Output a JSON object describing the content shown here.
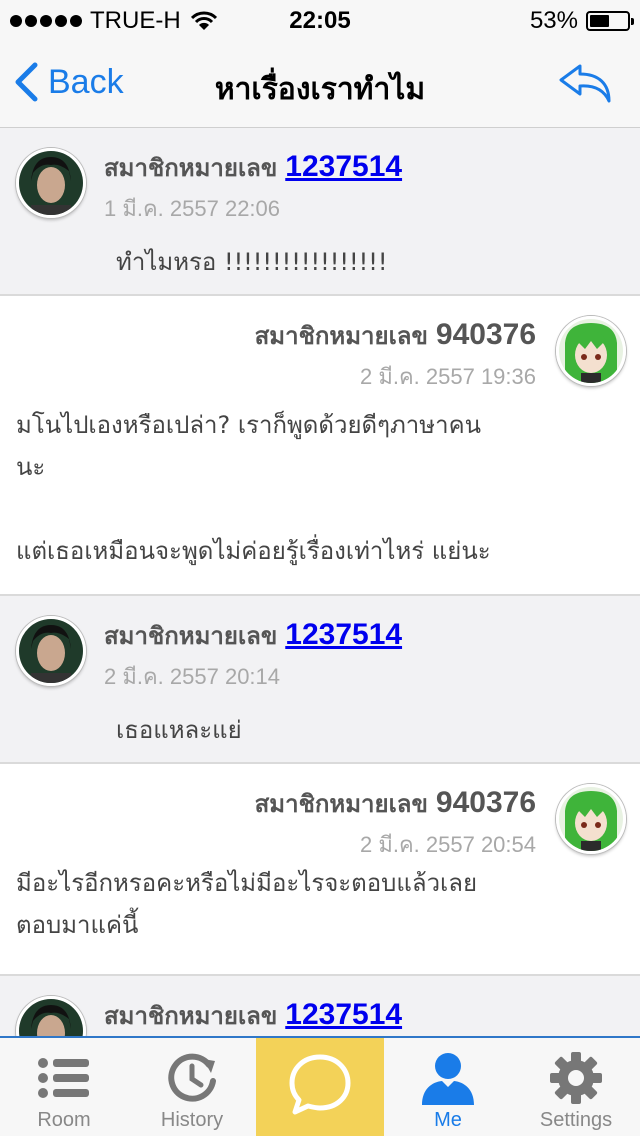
{
  "status_bar": {
    "carrier": "TRUE-H",
    "time": "22:05",
    "battery_percent": "53%",
    "battery_level": 0.53
  },
  "nav": {
    "back_label": "Back",
    "title": "หาเรื่องเราทำไม",
    "reply_icon": "reply-arrow-icon"
  },
  "messages": [
    {
      "side": "left",
      "member_label": "สมาชิกหมายเลข",
      "member_number": "1237514",
      "date": "1 มี.ค. 2557 22:06",
      "text": "ทำไมหรอ   !!!!!!!!!!!!!!!!!"
    },
    {
      "side": "right",
      "member_label": "สมาชิกหมายเลข",
      "member_number": "940376",
      "date": "2 มี.ค. 2557 19:36",
      "text": "มโนไปเองหรือเปล่า? เราก็พูดด้วยดีๆภาษาคน\nนะ\n\nแต่เธอเหมือนจะพูดไม่ค่อยรู้เรื่องเท่าไหร่ แย่นะ"
    },
    {
      "side": "left",
      "member_label": "สมาชิกหมายเลข",
      "member_number": "1237514",
      "date": "2 มี.ค. 2557 20:14",
      "text": "เธอแหละแย่"
    },
    {
      "side": "right",
      "member_label": "สมาชิกหมายเลข",
      "member_number": "940376",
      "date": "2 มี.ค. 2557 20:54",
      "text": "มีอะไรอีกหรอคะหรือไม่มีอะไรจะตอบแล้วเลย\nตอบมาแค่นี้"
    },
    {
      "side": "left",
      "member_label": "สมาชิกหมายเลข",
      "member_number": "1237514",
      "date": "",
      "text": ""
    }
  ],
  "tabs": [
    {
      "label": "Room",
      "icon": "list-icon",
      "active": false
    },
    {
      "label": "History",
      "icon": "history-clock-icon",
      "active": false
    },
    {
      "label": "",
      "icon": "chat-bubble-icon",
      "active": false
    },
    {
      "label": "Me",
      "icon": "person-icon",
      "active": true
    },
    {
      "label": "Settings",
      "icon": "gear-icon",
      "active": false
    }
  ],
  "colors": {
    "accent": "#1a7ce8",
    "center_tab": "#f3d258",
    "link": "#0000ee",
    "gray_row": "#f2f2f4"
  }
}
